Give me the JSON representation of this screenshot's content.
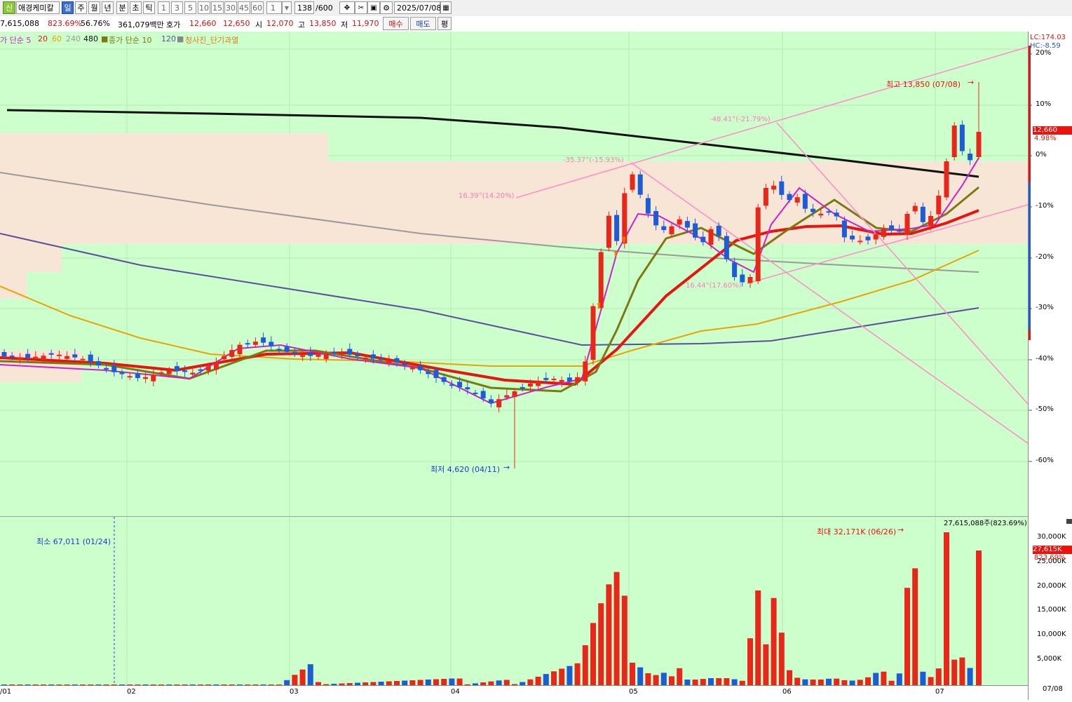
{
  "toolbar": {
    "badge": "신",
    "stock_name": "애경케미칼",
    "periods": [
      "일",
      "주",
      "월",
      "년",
      "분",
      "초",
      "틱"
    ],
    "active_period": "일",
    "minute_options": [
      "1",
      "3",
      "5",
      "10",
      "15",
      "30",
      "45",
      "60"
    ],
    "unit_value": "1",
    "count": "138",
    "count_total": "/600",
    "date": "2025/07/08"
  },
  "info": {
    "volume": "7,615,088",
    "vol_ratio": "823.69%",
    "turnover": "56.76%",
    "amount": "361,079백만",
    "quote_label": "호가",
    "ask": "12,660",
    "bid": "12,650",
    "open_label": "시",
    "open": "12,070",
    "high_label": "고",
    "high": "13,850",
    "low_label": "저",
    "low": "11,970",
    "buy_label": "매수",
    "sell_label": "매도",
    "avg_label": "평"
  },
  "legend": {
    "ma_price_label": "가 단순 5",
    "ma_20": "20",
    "ma_60": "60",
    "ma_240": "240",
    "ma_480": "480",
    "close_ma_label": "종가 단순 10",
    "close_ma_120": "120",
    "indicator": "청사진_단기과열"
  },
  "colors": {
    "bg": "#ccffcc",
    "up": "#e8271a",
    "down": "#1c5cd6",
    "ma5": "#cc22cc",
    "ma10": "#7a7a10",
    "ma20": "#e8150f",
    "ma60": "#e8a400",
    "ma120": "#5a4f9a",
    "ma240": "#9a9a9a",
    "ma480": "#111111",
    "trend": "#ff8fc8",
    "zone": "#f7e6d6"
  },
  "right_axis": {
    "lc": "LC:174.03",
    "hc": "HC:-8.59",
    "price_ticks": [
      "20%",
      "10%",
      "0%",
      "-10%",
      "-20%",
      "-30%",
      "-40%",
      "-50%",
      "-60%"
    ],
    "price_tag": "12,660",
    "price_pct": "4.98%",
    "vol_ticks": [
      "30,000K",
      "25,000K",
      "20,000K",
      "15,000K",
      "10,000K",
      "5,000K"
    ],
    "vol_tag": "27,615K",
    "vol_pct": "823.69%"
  },
  "x_axis": {
    "labels": [
      "/01",
      "02",
      "03",
      "04",
      "05",
      "06",
      "07",
      "07/08"
    ]
  },
  "annotations": {
    "high": "최고 13,850 (07/08)",
    "low": "최저 4,620 (04/11)",
    "vol_max": "최대 32,171K (06/26)",
    "vol_min": "최소 67,011 (01/24)",
    "vol_top": "27,615,088주(823.69%)",
    "t1": "16.39°(14.20%)",
    "t2": "-35.37°(-15.93%)",
    "t3": "-48.41°(-21.79%)",
    "t4": "16.44°(17.60%)"
  },
  "chart_data": {
    "type": "candlestick",
    "title": "애경케미칼",
    "x_range": [
      "2025/01/01",
      "2025/07/08"
    ],
    "last": {
      "open": 12070,
      "high": 13850,
      "low": 11970,
      "close": 12660
    },
    "price_change_pct": 4.98,
    "period_high": {
      "value": 13850,
      "date": "07/08"
    },
    "period_low": {
      "value": 4620,
      "date": "04/11"
    },
    "volume": {
      "last": 27615088,
      "last_ratio_pct": 823.69,
      "max": 32171000,
      "max_date": "06/26",
      "min": 67011,
      "min_date": "01/24"
    },
    "y_axis_percent": [
      20,
      10,
      0,
      -10,
      -20,
      -30,
      -40,
      -50,
      -60
    ],
    "moving_averages": [
      "5",
      "10",
      "20",
      "60",
      "120",
      "240",
      "480"
    ],
    "grid": true
  }
}
